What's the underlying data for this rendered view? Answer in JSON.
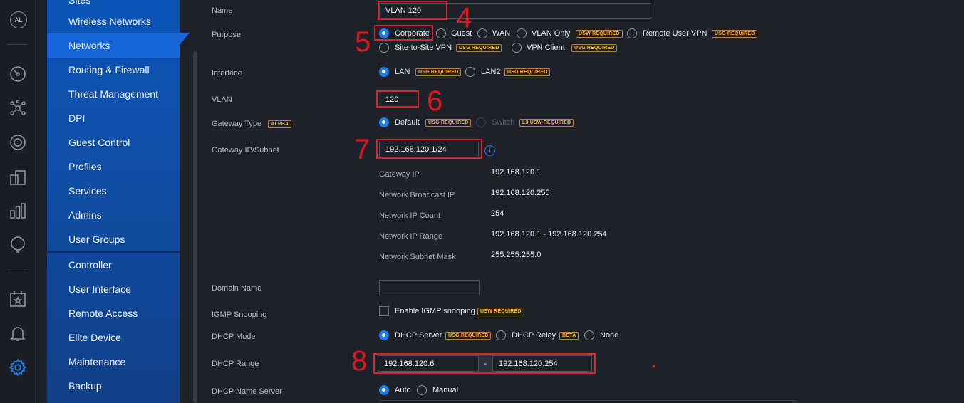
{
  "rail": {
    "avatar": "AL",
    "icons": [
      "dashboard-icon",
      "topology-icon",
      "devices-icon",
      "clients-icon",
      "statistics-icon",
      "insights-icon",
      "events-icon",
      "alerts-icon",
      "settings-icon"
    ]
  },
  "sidebar": {
    "items": [
      {
        "label": "Sites"
      },
      {
        "label": "Wireless Networks"
      },
      {
        "label": "Networks"
      },
      {
        "label": "Routing & Firewall"
      },
      {
        "label": "Threat Management"
      },
      {
        "label": "DPI"
      },
      {
        "label": "Guest Control"
      },
      {
        "label": "Profiles"
      },
      {
        "label": "Services"
      },
      {
        "label": "Admins"
      },
      {
        "label": "User Groups"
      },
      {
        "label": "Controller"
      },
      {
        "label": "User Interface"
      },
      {
        "label": "Remote Access"
      },
      {
        "label": "Elite Device"
      },
      {
        "label": "Maintenance"
      },
      {
        "label": "Backup"
      }
    ]
  },
  "form": {
    "name_label": "Name",
    "name_value": "VLAN 120",
    "purpose_label": "Purpose",
    "purpose_options": [
      "Corporate",
      "Guest",
      "WAN",
      "VLAN Only",
      "Remote User VPN",
      "Site-to-Site VPN",
      "VPN Client"
    ],
    "usw_required": "USW REQUIRED",
    "usg_required": "USG REQUIRED",
    "alpha": "ALPHA",
    "beta": "BETA",
    "l3_usw_required": "L3 USW REQUIRED",
    "interface_label": "Interface",
    "interface_options": [
      "LAN",
      "LAN2"
    ],
    "vlan_label": "VLAN",
    "vlan_value": "120",
    "gateway_type_label": "Gateway Type",
    "gateway_type_options": [
      "Default",
      "Switch"
    ],
    "gateway_ip_label": "Gateway IP/Subnet",
    "gateway_ip_value": "192.168.120.1/24",
    "info": [
      {
        "k": "Gateway IP",
        "v": "192.168.120.1"
      },
      {
        "k": "Network Broadcast IP",
        "v": "192.168.120.255"
      },
      {
        "k": "Network IP Count",
        "v": "254"
      },
      {
        "k": "Network IP Range",
        "v": "192.168.120.1 - 192.168.120.254"
      },
      {
        "k": "Network Subnet Mask",
        "v": "255.255.255.0"
      }
    ],
    "domain_label": "Domain Name",
    "igmp_label": "IGMP Snooping",
    "igmp_option": "Enable IGMP snooping",
    "dhcp_mode_label": "DHCP Mode",
    "dhcp_mode_options": [
      "DHCP Server",
      "DHCP Relay",
      "None"
    ],
    "dhcp_range_label": "DHCP Range",
    "dhcp_start": "192.168.120.6",
    "dhcp_sep": "-",
    "dhcp_end": "192.168.120.254",
    "dhcp_ns_label": "DHCP Name Server",
    "dhcp_ns_options": [
      "Auto",
      "Manual"
    ]
  },
  "annotations": {
    "n4": "4",
    "n5": "5",
    "n6": "6",
    "n7": "7",
    "n8": "8"
  },
  "colors": {
    "accent": "#1a7ff0",
    "sidebar": "#0c54b8",
    "annotation": "#d8242a",
    "badge": "#ffb03a"
  }
}
